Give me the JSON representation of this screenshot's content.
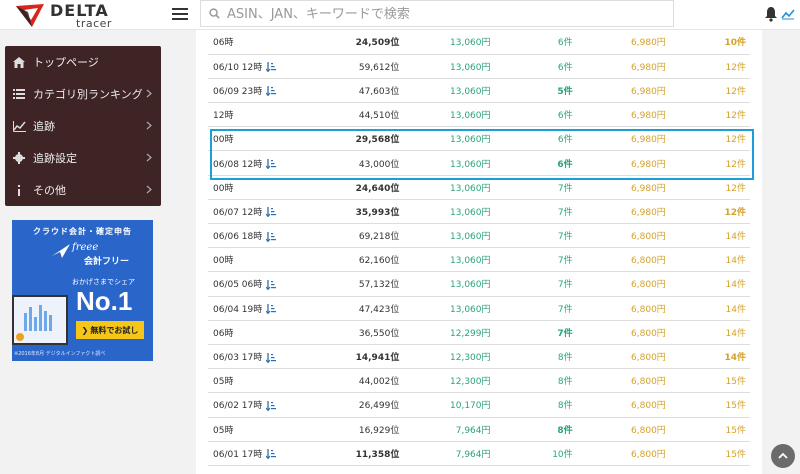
{
  "header": {
    "logo_title": "DELTA",
    "logo_sub": "tracer",
    "search_placeholder": "ASIN、JAN、キーワードで検索"
  },
  "sidebar": {
    "items": [
      {
        "label": "トップページ",
        "icon": "home-icon",
        "has_chevron": false
      },
      {
        "label": "カテゴリ別ランキング",
        "icon": "list-icon",
        "has_chevron": true
      },
      {
        "label": "追跡",
        "icon": "line-chart-icon",
        "has_chevron": true
      },
      {
        "label": "追跡設定",
        "icon": "gear-icon",
        "has_chevron": true
      },
      {
        "label": "その他",
        "icon": "info-icon",
        "has_chevron": true
      }
    ]
  },
  "ad": {
    "top": "クラウド会計・確定申告",
    "brand": "freee",
    "product": "会計フリー",
    "share": "おかげさまでシェア",
    "no1": "No.1",
    "button": "無料でお試し",
    "note": "※2016年8月 デジタルインファクト調べ"
  },
  "rows": [
    {
      "time": "06時",
      "sort": false,
      "rank": "24,509位",
      "rank_bold": true,
      "price": "13,060円",
      "count": "6件",
      "count_bold": false,
      "price2": "6,980円",
      "count2": "10件",
      "count2_bold": true
    },
    {
      "time": "06/10 12時",
      "sort": true,
      "rank": "59,612位",
      "rank_bold": false,
      "price": "13,060円",
      "count": "6件",
      "count_bold": false,
      "price2": "6,980円",
      "count2": "12件",
      "count2_bold": false
    },
    {
      "time": "06/09 23時",
      "sort": true,
      "rank": "47,603位",
      "rank_bold": false,
      "price": "13,060円",
      "count": "5件",
      "count_bold": true,
      "price2": "6,980円",
      "count2": "12件",
      "count2_bold": false
    },
    {
      "time": "12時",
      "sort": false,
      "rank": "44,510位",
      "rank_bold": false,
      "price": "13,060円",
      "count": "6件",
      "count_bold": false,
      "price2": "6,980円",
      "count2": "12件",
      "count2_bold": false
    },
    {
      "time": "00時",
      "sort": false,
      "rank": "29,568位",
      "rank_bold": true,
      "price": "13,060円",
      "count": "6件",
      "count_bold": false,
      "price2": "6,980円",
      "count2": "12件",
      "count2_bold": false
    },
    {
      "time": "06/08 12時",
      "sort": true,
      "rank": "43,000位",
      "rank_bold": false,
      "price": "13,060円",
      "count": "6件",
      "count_bold": true,
      "price2": "6,980円",
      "count2": "12件",
      "count2_bold": false
    },
    {
      "time": "00時",
      "sort": false,
      "rank": "24,640位",
      "rank_bold": true,
      "price": "13,060円",
      "count": "7件",
      "count_bold": false,
      "price2": "6,980円",
      "count2": "12件",
      "count2_bold": false
    },
    {
      "time": "06/07 12時",
      "sort": true,
      "rank": "35,993位",
      "rank_bold": true,
      "price": "13,060円",
      "count": "7件",
      "count_bold": false,
      "price2": "6,980円",
      "count2": "12件",
      "count2_bold": true
    },
    {
      "time": "06/06 18時",
      "sort": true,
      "rank": "69,218位",
      "rank_bold": false,
      "price": "13,060円",
      "count": "7件",
      "count_bold": false,
      "price2": "6,800円",
      "count2": "14件",
      "count2_bold": false
    },
    {
      "time": "00時",
      "sort": false,
      "rank": "62,160位",
      "rank_bold": false,
      "price": "13,060円",
      "count": "7件",
      "count_bold": false,
      "price2": "6,800円",
      "count2": "14件",
      "count2_bold": false
    },
    {
      "time": "06/05 06時",
      "sort": true,
      "rank": "57,132位",
      "rank_bold": false,
      "price": "13,060円",
      "count": "7件",
      "count_bold": false,
      "price2": "6,800円",
      "count2": "14件",
      "count2_bold": false
    },
    {
      "time": "06/04 19時",
      "sort": true,
      "rank": "47,423位",
      "rank_bold": false,
      "price": "13,060円",
      "count": "7件",
      "count_bold": false,
      "price2": "6,800円",
      "count2": "14件",
      "count2_bold": false
    },
    {
      "time": "06時",
      "sort": false,
      "rank": "36,550位",
      "rank_bold": false,
      "price": "12,299円",
      "count": "7件",
      "count_bold": true,
      "price2": "6,800円",
      "count2": "14件",
      "count2_bold": false
    },
    {
      "time": "06/03 17時",
      "sort": true,
      "rank": "14,941位",
      "rank_bold": true,
      "price": "12,300円",
      "count": "8件",
      "count_bold": false,
      "price2": "6,800円",
      "count2": "14件",
      "count2_bold": true
    },
    {
      "time": "05時",
      "sort": false,
      "rank": "44,002位",
      "rank_bold": false,
      "price": "12,300円",
      "count": "8件",
      "count_bold": false,
      "price2": "6,800円",
      "count2": "15件",
      "count2_bold": false
    },
    {
      "time": "06/02 17時",
      "sort": true,
      "rank": "26,499位",
      "rank_bold": false,
      "price": "10,170円",
      "count": "8件",
      "count_bold": false,
      "price2": "6,800円",
      "count2": "15件",
      "count2_bold": false
    },
    {
      "time": "05時",
      "sort": false,
      "rank": "16,929位",
      "rank_bold": false,
      "price": "7,964円",
      "count": "8件",
      "count_bold": true,
      "price2": "6,800円",
      "count2": "15件",
      "count2_bold": false
    },
    {
      "time": "06/01 17時",
      "sort": true,
      "rank": "11,358位",
      "rank_bold": true,
      "price": "7,964円",
      "count": "10件",
      "count_bold": false,
      "price2": "6,800円",
      "count2": "15件",
      "count2_bold": false
    }
  ],
  "colors": {
    "accent": "#1a9fd8",
    "green": "#2aa47a",
    "gold": "#d6a12a",
    "sidebar": "#3e2424",
    "logo_red": "#d9261c"
  }
}
